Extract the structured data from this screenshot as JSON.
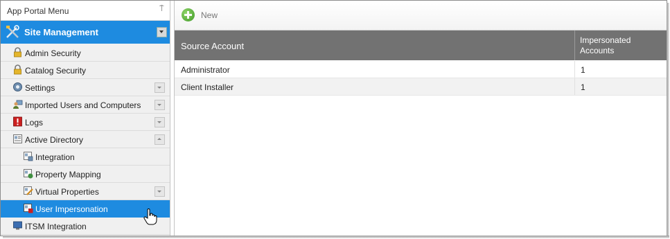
{
  "sidebar": {
    "title": "App Portal Menu",
    "pin_icon": "pin-icon",
    "section": {
      "label": "Site Management",
      "icon": "tools-icon"
    },
    "items": [
      {
        "label": "Admin Security",
        "icon": "lock-icon"
      },
      {
        "label": "Catalog Security",
        "icon": "lock-icon"
      },
      {
        "label": "Settings",
        "icon": "gear-icon"
      },
      {
        "label": "Imported Users and Computers",
        "icon": "users-icon"
      },
      {
        "label": "Logs",
        "icon": "log-icon"
      },
      {
        "label": "Active Directory",
        "icon": "directory-icon"
      },
      {
        "label": "Integration",
        "icon": "integration-icon"
      },
      {
        "label": "Property Mapping",
        "icon": "property-mapping-icon"
      },
      {
        "label": "Virtual Properties",
        "icon": "virtual-properties-icon"
      },
      {
        "label": "User Impersonation",
        "icon": "user-impersonation-icon"
      },
      {
        "label": "ITSM Integration",
        "icon": "itsm-icon"
      }
    ]
  },
  "toolbar": {
    "new_label": "New"
  },
  "grid": {
    "columns": [
      "Source Account",
      "Impersonated Accounts"
    ],
    "rows": [
      {
        "source": "Administrator",
        "count": "1"
      },
      {
        "source": "Client Installer",
        "count": "1"
      }
    ]
  },
  "colors": {
    "accent": "#1e8be0",
    "header": "#727272"
  }
}
